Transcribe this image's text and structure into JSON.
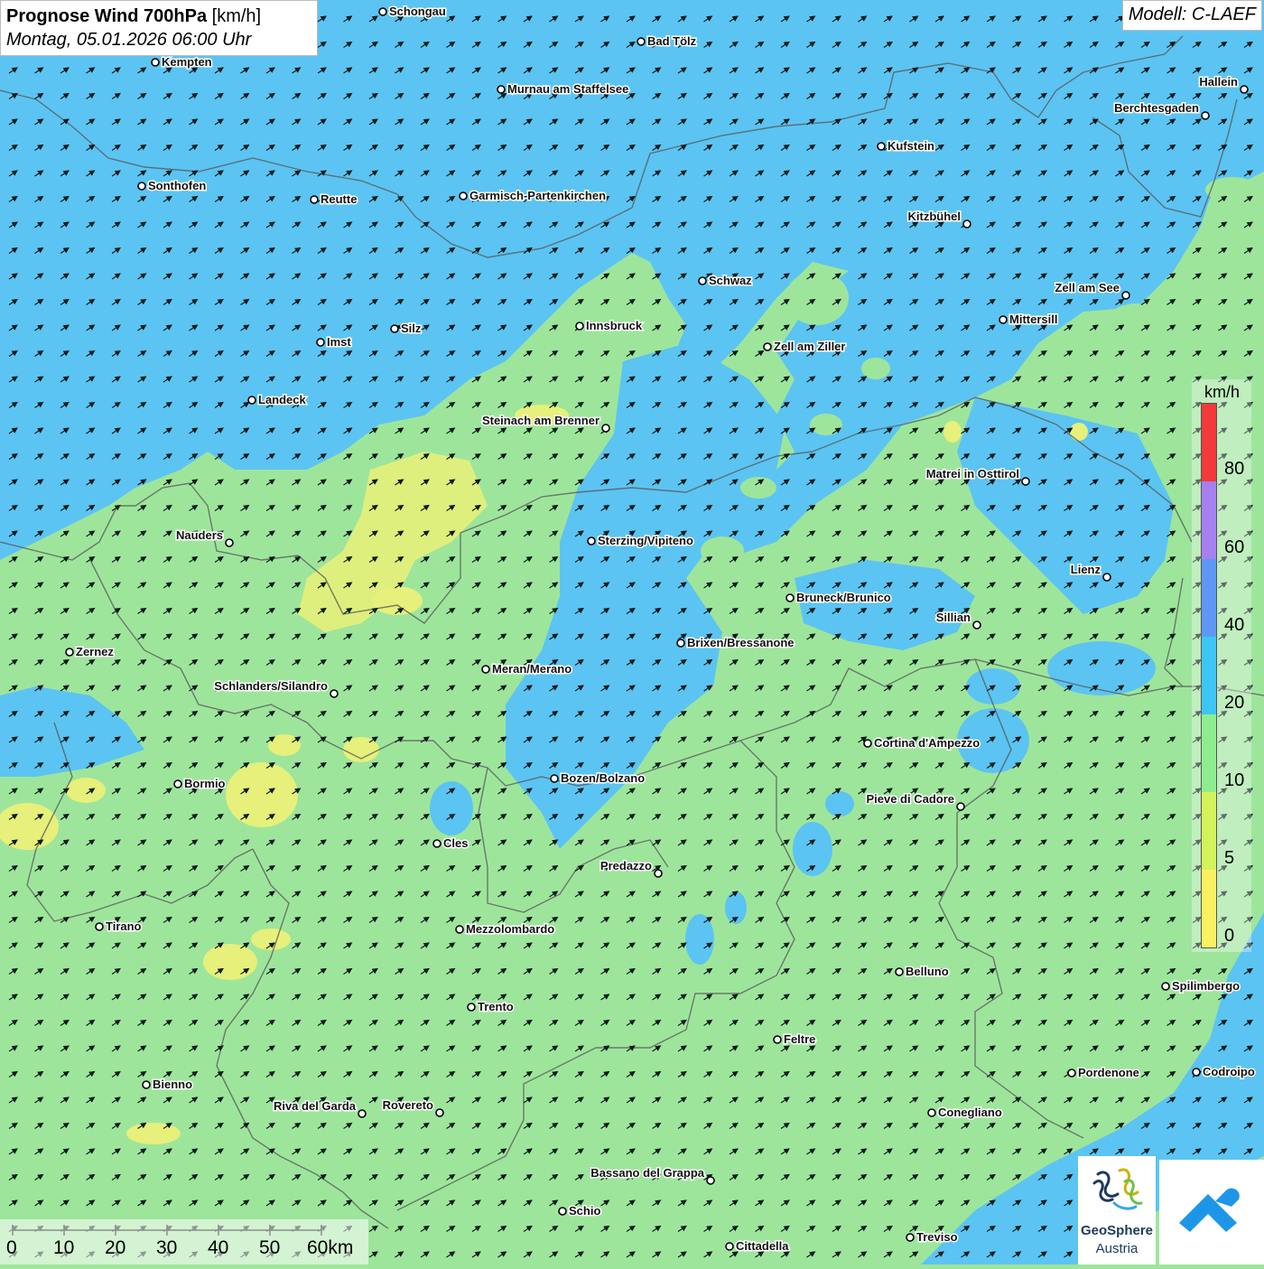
{
  "header": {
    "title_bold": "Prognose Wind 700hPa",
    "title_unit": "[km/h]",
    "subtitle": "Montag, 05.01.2026 06:00 Uhr",
    "model": "Modell: C-LAEF"
  },
  "legend": {
    "unit": "km/h",
    "labels": [
      "80",
      "60",
      "40",
      "20",
      "10",
      "5",
      "0"
    ],
    "colors": [
      "#f23a3a",
      "#a680f0",
      "#5e98f4",
      "#3dc6f4",
      "#8fed8f",
      "#d4f25a",
      "#fbf060"
    ]
  },
  "scale_bar": {
    "labels": [
      "0",
      "10",
      "20",
      "30",
      "40",
      "50",
      "60km"
    ]
  },
  "logos": {
    "geosphere_name": "GeoSphere",
    "geosphere_sub": "Austria",
    "geosphere_icon": "geosphere-logo-icon",
    "app_icon": "weather-app-logo-icon"
  },
  "colors": {
    "calm_green": "#9ee59c",
    "moderate_blue": "#5cc4f2",
    "light_yellow": "#e6f07a",
    "arrow": "#0b1a1a"
  },
  "wind": {
    "direction_icon": "arrow-northeast-icon",
    "direction_label": "SW wind, arrows pointing NE"
  },
  "cities": [
    {
      "name": "Schongau"
    },
    {
      "name": "Bad Tölz"
    },
    {
      "name": "Kempten"
    },
    {
      "name": "Murnau am Staffelsee"
    },
    {
      "name": "Hallein"
    },
    {
      "name": "Berchtesgaden"
    },
    {
      "name": "Kufstein"
    },
    {
      "name": "Sonthofen"
    },
    {
      "name": "Reutte"
    },
    {
      "name": "Garmisch-Partenkirchen"
    },
    {
      "name": "Kitzbühel"
    },
    {
      "name": "Schwaz"
    },
    {
      "name": "Zell am See"
    },
    {
      "name": "Innsbruck"
    },
    {
      "name": "Mittersill"
    },
    {
      "name": "Silz"
    },
    {
      "name": "Zell am Ziller"
    },
    {
      "name": "Imst"
    },
    {
      "name": "Landeck"
    },
    {
      "name": "Steinach am Brenner"
    },
    {
      "name": "Matrei in Osttirol"
    },
    {
      "name": "Nauders"
    },
    {
      "name": "Sterzing/Vipiteno"
    },
    {
      "name": "Lienz"
    },
    {
      "name": "Bruneck/Brunico"
    },
    {
      "name": "Sillian"
    },
    {
      "name": "Brixen/Bressanone"
    },
    {
      "name": "Zernez"
    },
    {
      "name": "Meran/Merano"
    },
    {
      "name": "Schlanders/Silandro"
    },
    {
      "name": "Cortina d'Ampezzo"
    },
    {
      "name": "Bormio"
    },
    {
      "name": "Bozen/Bolzano"
    },
    {
      "name": "Pieve di Cadore"
    },
    {
      "name": "Cles"
    },
    {
      "name": "Predazzo"
    },
    {
      "name": "Tirano"
    },
    {
      "name": "Mezzolombardo"
    },
    {
      "name": "Belluno"
    },
    {
      "name": "Spilimbergo"
    },
    {
      "name": "Trento"
    },
    {
      "name": "Feltre"
    },
    {
      "name": "Pordenone"
    },
    {
      "name": "Codroipo"
    },
    {
      "name": "Bienno"
    },
    {
      "name": "Riva del Garda"
    },
    {
      "name": "Rovereto"
    },
    {
      "name": "Conegliano"
    },
    {
      "name": "Bassano del Grappa"
    },
    {
      "name": "Schio"
    },
    {
      "name": "Treviso"
    },
    {
      "name": "Cittadella"
    }
  ]
}
